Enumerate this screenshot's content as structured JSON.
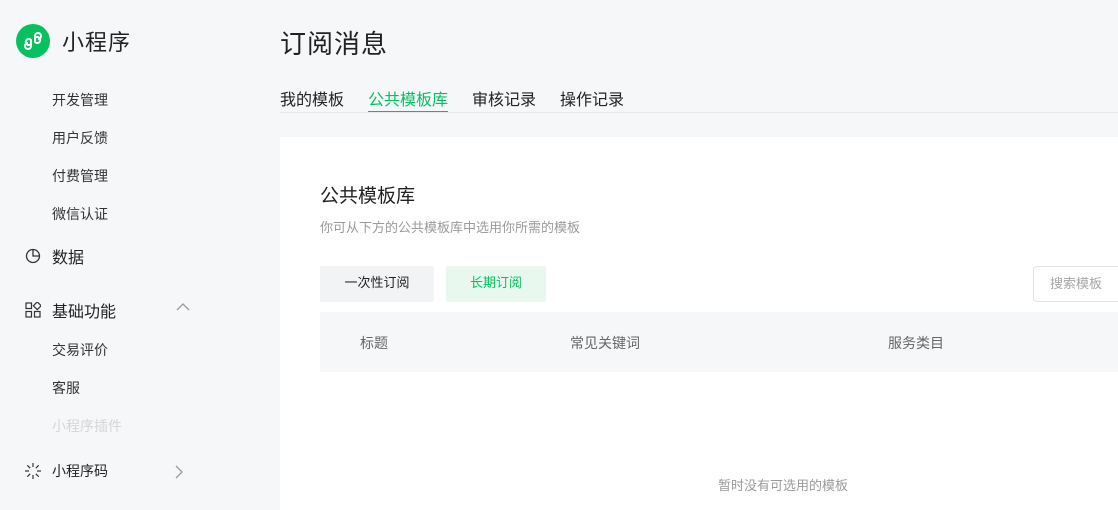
{
  "brand": {
    "name": "小程序"
  },
  "sidebar": {
    "sub_items_top": [
      "开发管理",
      "用户反馈",
      "付费管理",
      "微信认证"
    ],
    "data_group": {
      "label": "数据",
      "icon": "pie-chart-icon"
    },
    "basic_group": {
      "label": "基础功能",
      "icon": "grid-icon",
      "expanded": true
    },
    "basic_items": [
      "交易评价",
      "客服",
      "小程序插件"
    ],
    "qrcode_group": {
      "label": "小程序码",
      "icon": "qrcode-icon"
    }
  },
  "page": {
    "title": "订阅消息"
  },
  "tabs": [
    {
      "label": "我的模板",
      "active": false
    },
    {
      "label": "公共模板库",
      "active": true
    },
    {
      "label": "审核记录",
      "active": false
    },
    {
      "label": "操作记录",
      "active": false
    }
  ],
  "library": {
    "title": "公共模板库",
    "subtitle": "你可从下方的公共模板库中选用你所需的模板",
    "type_buttons": [
      "一次性订阅",
      "长期订阅"
    ],
    "selected_type": "长期订阅",
    "search_placeholder": "搜索模板",
    "columns": [
      "标题",
      "常见关键词",
      "服务类目"
    ],
    "empty_text": "暂时没有可选用的模板"
  },
  "colors": {
    "accent": "#07c160",
    "accent_bg": "#e8f8ee",
    "sidebar_bg": "#f6f7f9"
  }
}
